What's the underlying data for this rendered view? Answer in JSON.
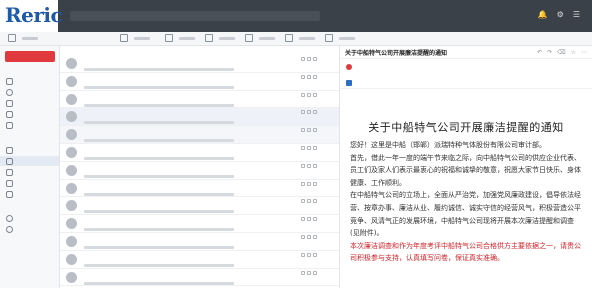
{
  "brand": {
    "logo_text": "Reric",
    "logo_subtext": ""
  },
  "topbar": {
    "icons": [
      "bell-icon",
      "gear-icon",
      "user-icon"
    ],
    "icon_glyphs": [
      "🔔",
      "⚙",
      "☰"
    ]
  },
  "toolbar": {
    "items": [
      {
        "icon": "inbox-icon",
        "label": ""
      },
      {
        "icon": "reply-icon",
        "label": ""
      },
      {
        "icon": "contacts-icon",
        "label": ""
      },
      {
        "icon": "calendar-icon",
        "label": ""
      },
      {
        "icon": "note-icon",
        "label": ""
      },
      {
        "icon": "task-icon",
        "label": ""
      },
      {
        "icon": "edit-icon",
        "label": ""
      }
    ]
  },
  "nav": {
    "write_label": "",
    "section_mail": "",
    "mail_items": [
      {
        "label": "",
        "count": ""
      },
      {
        "label": "",
        "count": ""
      },
      {
        "label": "",
        "count": ""
      },
      {
        "label": "",
        "count": ""
      },
      {
        "label": "",
        "count": ""
      }
    ],
    "section_folders": "",
    "folder_items": [
      {
        "label": "",
        "count": ""
      },
      {
        "label": "",
        "count": ""
      },
      {
        "label": "",
        "count": ""
      },
      {
        "label": "",
        "count": ""
      },
      {
        "label": "",
        "count": ""
      }
    ],
    "section_other": "",
    "other_items": [
      {
        "label": ""
      },
      {
        "label": ""
      }
    ]
  },
  "list": {
    "header_left": "",
    "header_right": "",
    "messages": [
      {
        "from": "",
        "subject": "",
        "time": ""
      },
      {
        "from": "",
        "subject": "",
        "time": ""
      },
      {
        "from": "",
        "subject": "",
        "time": ""
      },
      {
        "from": "",
        "subject": "",
        "time": ""
      },
      {
        "from": "",
        "subject": "",
        "time": ""
      },
      {
        "from": "",
        "subject": "",
        "time": ""
      },
      {
        "from": "",
        "subject": "",
        "time": ""
      },
      {
        "from": "",
        "subject": "",
        "time": ""
      },
      {
        "from": "",
        "subject": "",
        "time": ""
      },
      {
        "from": "",
        "subject": "",
        "time": ""
      },
      {
        "from": "",
        "subject": "",
        "time": ""
      },
      {
        "from": "",
        "subject": "",
        "time": ""
      },
      {
        "from": "",
        "subject": "",
        "time": ""
      }
    ]
  },
  "reader": {
    "title": "关于中船特气公司开展廉洁提醒的通知",
    "sender": "",
    "recipient": "",
    "date": "",
    "doc_title": "关于中船特气公司开展廉洁提醒的通知",
    "paragraphs": [
      "您好！这里是中船（邯郸）派瑞特种气体股份有限公司审计部。",
      "首先，借此一年一度的端午节来临之际，向中船特气公司的供应企业代表、员工们及家人们表示最衷心的祝福和诚挚的敬意，祝愿大家节日快乐、身体健康、工作顺利。",
      "在中船特气公司的立场上，全面从严治党，加强党风廉政建设，倡导依法经营、按章办事、廉洁从业、履约诚信、诚实守信的经营风气，积极营造公平竞争、风清气正的发展环境，中船特气公司现将开展本次廉洁提醒和调查(见附件)。"
    ],
    "red_paragraph": "本次廉洁调查和作为年度考评中船特气公司合格供方主要依据之一，请贵公司积极参与支持，认真填写问卷，保证真实准确。"
  }
}
